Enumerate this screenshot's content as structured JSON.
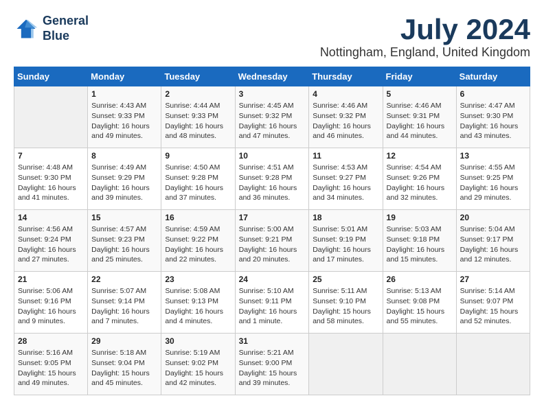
{
  "logo": {
    "line1": "General",
    "line2": "Blue"
  },
  "title": {
    "month_year": "July 2024",
    "location": "Nottingham, England, United Kingdom"
  },
  "days_of_week": [
    "Sunday",
    "Monday",
    "Tuesday",
    "Wednesday",
    "Thursday",
    "Friday",
    "Saturday"
  ],
  "weeks": [
    [
      {
        "day": "",
        "info": ""
      },
      {
        "day": "1",
        "info": "Sunrise: 4:43 AM\nSunset: 9:33 PM\nDaylight: 16 hours\nand 49 minutes."
      },
      {
        "day": "2",
        "info": "Sunrise: 4:44 AM\nSunset: 9:33 PM\nDaylight: 16 hours\nand 48 minutes."
      },
      {
        "day": "3",
        "info": "Sunrise: 4:45 AM\nSunset: 9:32 PM\nDaylight: 16 hours\nand 47 minutes."
      },
      {
        "day": "4",
        "info": "Sunrise: 4:46 AM\nSunset: 9:32 PM\nDaylight: 16 hours\nand 46 minutes."
      },
      {
        "day": "5",
        "info": "Sunrise: 4:46 AM\nSunset: 9:31 PM\nDaylight: 16 hours\nand 44 minutes."
      },
      {
        "day": "6",
        "info": "Sunrise: 4:47 AM\nSunset: 9:30 PM\nDaylight: 16 hours\nand 43 minutes."
      }
    ],
    [
      {
        "day": "7",
        "info": "Sunrise: 4:48 AM\nSunset: 9:30 PM\nDaylight: 16 hours\nand 41 minutes."
      },
      {
        "day": "8",
        "info": "Sunrise: 4:49 AM\nSunset: 9:29 PM\nDaylight: 16 hours\nand 39 minutes."
      },
      {
        "day": "9",
        "info": "Sunrise: 4:50 AM\nSunset: 9:28 PM\nDaylight: 16 hours\nand 37 minutes."
      },
      {
        "day": "10",
        "info": "Sunrise: 4:51 AM\nSunset: 9:28 PM\nDaylight: 16 hours\nand 36 minutes."
      },
      {
        "day": "11",
        "info": "Sunrise: 4:53 AM\nSunset: 9:27 PM\nDaylight: 16 hours\nand 34 minutes."
      },
      {
        "day": "12",
        "info": "Sunrise: 4:54 AM\nSunset: 9:26 PM\nDaylight: 16 hours\nand 32 minutes."
      },
      {
        "day": "13",
        "info": "Sunrise: 4:55 AM\nSunset: 9:25 PM\nDaylight: 16 hours\nand 29 minutes."
      }
    ],
    [
      {
        "day": "14",
        "info": "Sunrise: 4:56 AM\nSunset: 9:24 PM\nDaylight: 16 hours\nand 27 minutes."
      },
      {
        "day": "15",
        "info": "Sunrise: 4:57 AM\nSunset: 9:23 PM\nDaylight: 16 hours\nand 25 minutes."
      },
      {
        "day": "16",
        "info": "Sunrise: 4:59 AM\nSunset: 9:22 PM\nDaylight: 16 hours\nand 22 minutes."
      },
      {
        "day": "17",
        "info": "Sunrise: 5:00 AM\nSunset: 9:21 PM\nDaylight: 16 hours\nand 20 minutes."
      },
      {
        "day": "18",
        "info": "Sunrise: 5:01 AM\nSunset: 9:19 PM\nDaylight: 16 hours\nand 17 minutes."
      },
      {
        "day": "19",
        "info": "Sunrise: 5:03 AM\nSunset: 9:18 PM\nDaylight: 16 hours\nand 15 minutes."
      },
      {
        "day": "20",
        "info": "Sunrise: 5:04 AM\nSunset: 9:17 PM\nDaylight: 16 hours\nand 12 minutes."
      }
    ],
    [
      {
        "day": "21",
        "info": "Sunrise: 5:06 AM\nSunset: 9:16 PM\nDaylight: 16 hours\nand 9 minutes."
      },
      {
        "day": "22",
        "info": "Sunrise: 5:07 AM\nSunset: 9:14 PM\nDaylight: 16 hours\nand 7 minutes."
      },
      {
        "day": "23",
        "info": "Sunrise: 5:08 AM\nSunset: 9:13 PM\nDaylight: 16 hours\nand 4 minutes."
      },
      {
        "day": "24",
        "info": "Sunrise: 5:10 AM\nSunset: 9:11 PM\nDaylight: 16 hours\nand 1 minute."
      },
      {
        "day": "25",
        "info": "Sunrise: 5:11 AM\nSunset: 9:10 PM\nDaylight: 15 hours\nand 58 minutes."
      },
      {
        "day": "26",
        "info": "Sunrise: 5:13 AM\nSunset: 9:08 PM\nDaylight: 15 hours\nand 55 minutes."
      },
      {
        "day": "27",
        "info": "Sunrise: 5:14 AM\nSunset: 9:07 PM\nDaylight: 15 hours\nand 52 minutes."
      }
    ],
    [
      {
        "day": "28",
        "info": "Sunrise: 5:16 AM\nSunset: 9:05 PM\nDaylight: 15 hours\nand 49 minutes."
      },
      {
        "day": "29",
        "info": "Sunrise: 5:18 AM\nSunset: 9:04 PM\nDaylight: 15 hours\nand 45 minutes."
      },
      {
        "day": "30",
        "info": "Sunrise: 5:19 AM\nSunset: 9:02 PM\nDaylight: 15 hours\nand 42 minutes."
      },
      {
        "day": "31",
        "info": "Sunrise: 5:21 AM\nSunset: 9:00 PM\nDaylight: 15 hours\nand 39 minutes."
      },
      {
        "day": "",
        "info": ""
      },
      {
        "day": "",
        "info": ""
      },
      {
        "day": "",
        "info": ""
      }
    ]
  ]
}
